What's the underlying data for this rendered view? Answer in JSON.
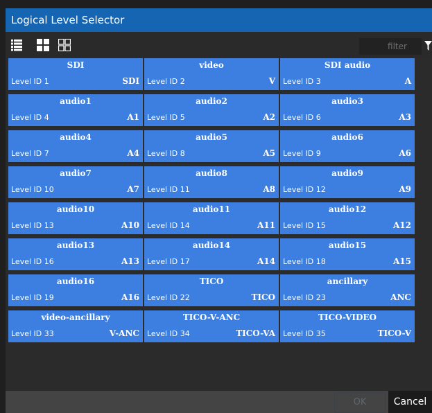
{
  "dialog": {
    "title": "Logical Level Selector"
  },
  "toolbar": {
    "views": [
      "list-view-icon",
      "large-grid-icon",
      "small-grid-icon"
    ],
    "filter_placeholder": "filter",
    "filter_icon": "filter-funnel-icon"
  },
  "levels": [
    {
      "name": "SDI",
      "level_id": "Level ID 1",
      "abbr": "SDI"
    },
    {
      "name": "video",
      "level_id": "Level ID 2",
      "abbr": "V"
    },
    {
      "name": "SDI audio",
      "level_id": "Level ID 3",
      "abbr": "A"
    },
    {
      "name": "audio1",
      "level_id": "Level ID 4",
      "abbr": "A1"
    },
    {
      "name": "audio2",
      "level_id": "Level ID 5",
      "abbr": "A2"
    },
    {
      "name": "audio3",
      "level_id": "Level ID 6",
      "abbr": "A3"
    },
    {
      "name": "audio4",
      "level_id": "Level ID 7",
      "abbr": "A4"
    },
    {
      "name": "audio5",
      "level_id": "Level ID 8",
      "abbr": "A5"
    },
    {
      "name": "audio6",
      "level_id": "Level ID 9",
      "abbr": "A6"
    },
    {
      "name": "audio7",
      "level_id": "Level ID 10",
      "abbr": "A7"
    },
    {
      "name": "audio8",
      "level_id": "Level ID 11",
      "abbr": "A8"
    },
    {
      "name": "audio9",
      "level_id": "Level ID 12",
      "abbr": "A9"
    },
    {
      "name": "audio10",
      "level_id": "Level ID 13",
      "abbr": "A10"
    },
    {
      "name": "audio11",
      "level_id": "Level ID 14",
      "abbr": "A11"
    },
    {
      "name": "audio12",
      "level_id": "Level ID 15",
      "abbr": "A12"
    },
    {
      "name": "audio13",
      "level_id": "Level ID 16",
      "abbr": "A13"
    },
    {
      "name": "audio14",
      "level_id": "Level ID 17",
      "abbr": "A14"
    },
    {
      "name": "audio15",
      "level_id": "Level ID 18",
      "abbr": "A15"
    },
    {
      "name": "audio16",
      "level_id": "Level ID 19",
      "abbr": "A16"
    },
    {
      "name": "TICO",
      "level_id": "Level ID 22",
      "abbr": "TICO"
    },
    {
      "name": "ancillary",
      "level_id": "Level ID 23",
      "abbr": "ANC"
    },
    {
      "name": "video-ancillary",
      "level_id": "Level ID 33",
      "abbr": "V-ANC"
    },
    {
      "name": "TICO-V-ANC",
      "level_id": "Level ID 34",
      "abbr": "TICO-VA"
    },
    {
      "name": "TICO-VIDEO",
      "level_id": "Level ID 35",
      "abbr": "TICO-V"
    }
  ],
  "footer": {
    "ok_label": "OK",
    "cancel_label": "Cancel"
  },
  "colors": {
    "title_bar": "#1565b3",
    "tile": "#3d7fe0",
    "background": "#2b2b2b"
  }
}
